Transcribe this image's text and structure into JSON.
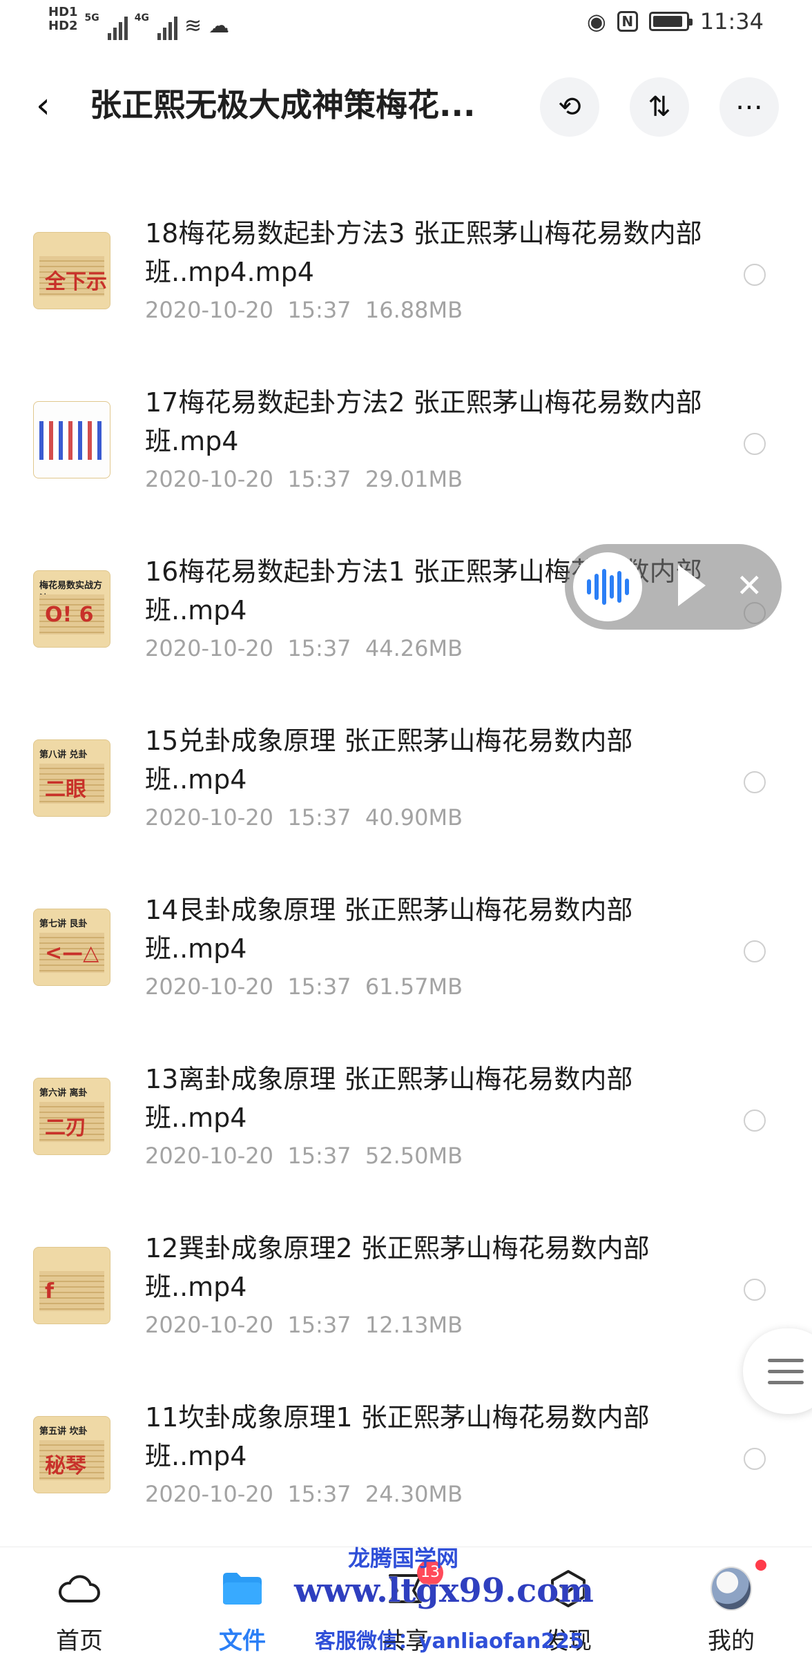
{
  "status_bar": {
    "hd1": "HD1",
    "hd2": "HD2",
    "net1": "5G",
    "net2": "4G",
    "time": "11:34",
    "battery_level": 0.92,
    "icons": [
      "hd-icon",
      "signal-icon",
      "wifi-icon",
      "wechat-icon",
      "eye-icon",
      "nfc-icon",
      "battery-icon"
    ]
  },
  "header": {
    "back_icon": "chevron-left-icon",
    "title": "张正熙无极大成神策梅花...",
    "history_icon": "history-icon",
    "sort_icon": "sort-icon",
    "more_icon": "more-icon"
  },
  "files": [
    {
      "name": "18梅花易数起卦方法3  张正熙茅山梅花易数内部班..mp4.mp4",
      "date": "2020-10-20",
      "time": "15:37",
      "size": "16.88MB",
      "thumb_title": "",
      "thumb_mark": "全下示"
    },
    {
      "name": "17梅花易数起卦方法2 张正熙茅山梅花易数内部班.mp4",
      "date": "2020-10-20",
      "time": "15:37",
      "size": "29.01MB",
      "thumb_title": "",
      "thumb_mark": ""
    },
    {
      "name": "16梅花易数起卦方法1  张正熙茅山梅花易数内部班..mp4",
      "date": "2020-10-20",
      "time": "15:37",
      "size": "44.26MB",
      "thumb_title": "梅花易数实战方法",
      "thumb_mark": "O! 6"
    },
    {
      "name": "15兑卦成象原理 张正熙茅山梅花易数内部班..mp4",
      "date": "2020-10-20",
      "time": "15:37",
      "size": "40.90MB",
      "thumb_title": "第八讲 兑卦",
      "thumb_mark": "二眼"
    },
    {
      "name": "14艮卦成象原理 张正熙茅山梅花易数内部班..mp4",
      "date": "2020-10-20",
      "time": "15:37",
      "size": "61.57MB",
      "thumb_title": "第七讲 艮卦",
      "thumb_mark": "<—△"
    },
    {
      "name": "13离卦成象原理 张正熙茅山梅花易数内部班..mp4",
      "date": "2020-10-20",
      "time": "15:37",
      "size": "52.50MB",
      "thumb_title": "第六讲 离卦",
      "thumb_mark": "二刃"
    },
    {
      "name": "12巽卦成象原理2 张正熙茅山梅花易数内部班..mp4",
      "date": "2020-10-20",
      "time": "15:37",
      "size": "12.13MB",
      "thumb_title": "",
      "thumb_mark": "f"
    },
    {
      "name": "11坎卦成象原理1 张正熙茅山梅花易数内部班..mp4",
      "date": "2020-10-20",
      "time": "15:37",
      "size": "24.30MB",
      "thumb_title": "第五讲 坎卦",
      "thumb_mark": "秘琴"
    }
  ],
  "player": {
    "wave_icon": "audio-wave-icon",
    "play_icon": "play-icon",
    "close_icon": "close-icon"
  },
  "bottom_nav": [
    {
      "label": "首页",
      "icon": "cloud-icon",
      "active": false
    },
    {
      "label": "文件",
      "icon": "folder-icon",
      "active": true
    },
    {
      "label": "共享",
      "icon": "share-icon",
      "active": false,
      "badge": "13"
    },
    {
      "label": "发现",
      "icon": "discover-icon",
      "active": false
    },
    {
      "label": "我的",
      "icon": "avatar-icon",
      "active": false
    }
  ],
  "watermark": {
    "line1": "龙腾国学网",
    "line2": "www.ltgx99.com",
    "line3": "客服微信：yanliaofan225"
  },
  "colors": {
    "accent": "#2b7ff6",
    "meta": "#a3a3a3",
    "badge": "#ff4a5a"
  }
}
